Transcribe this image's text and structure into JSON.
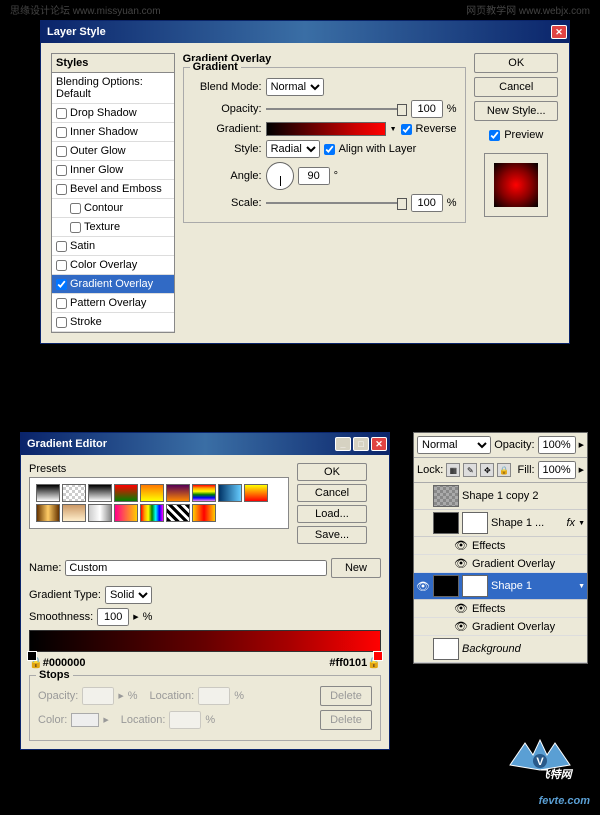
{
  "watermarks": {
    "left": "思缘设计论坛 www.missyuan.com",
    "right": "网页教学网 www.webjx.com",
    "logo": "fevte.com"
  },
  "layerStyle": {
    "title": "Layer Style",
    "stylesHeader": "Styles",
    "blendingOptions": "Blending Options: Default",
    "items": [
      "Drop Shadow",
      "Inner Shadow",
      "Outer Glow",
      "Inner Glow",
      "Bevel and Emboss",
      "Contour",
      "Texture",
      "Satin",
      "Color Overlay",
      "Gradient Overlay",
      "Pattern Overlay",
      "Stroke"
    ],
    "selected": "Gradient Overlay",
    "sectionTitle": "Gradient Overlay",
    "groupLegend": "Gradient",
    "labels": {
      "blendMode": "Blend Mode:",
      "opacity": "Opacity:",
      "gradient": "Gradient:",
      "style": "Style:",
      "angle": "Angle:",
      "scale": "Scale:"
    },
    "blendMode": "Normal",
    "opacity": "100",
    "opacityUnit": "%",
    "reverse": "Reverse",
    "styleValue": "Radial",
    "alignWithLayer": "Align with Layer",
    "angle": "90",
    "angleUnit": "°",
    "scale": "100",
    "scaleUnit": "%",
    "buttons": {
      "ok": "OK",
      "cancel": "Cancel",
      "newStyle": "New Style..."
    },
    "previewLabel": "Preview"
  },
  "gradientEditor": {
    "title": "Gradient Editor",
    "presetsLabel": "Presets",
    "buttons": {
      "ok": "OK",
      "cancel": "Cancel",
      "load": "Load...",
      "save": "Save..."
    },
    "nameLabel": "Name:",
    "nameValue": "Custom",
    "newBtn": "New",
    "gradTypeLabel": "Gradient Type:",
    "gradTypeValue": "Solid",
    "smoothLabel": "Smoothness:",
    "smoothValue": "100",
    "smoothUnit": "%",
    "hexLeft": "#000000",
    "hexRight": "#ff0101",
    "stopsLegend": "Stops",
    "stopLabels": {
      "opacity": "Opacity:",
      "location": "Location:",
      "color": "Color:",
      "delete": "Delete",
      "pct": "%"
    }
  },
  "layersPanel": {
    "blendMode": "Normal",
    "opacityLabel": "Opacity:",
    "opacity": "100%",
    "lockLabel": "Lock:",
    "fillLabel": "Fill:",
    "fill": "100%",
    "layers": [
      "Shape 1 copy 2",
      "Shape 1 ...",
      "Shape 1",
      "Background"
    ],
    "effectsLabel": "Effects",
    "gradOverlayLabel": "Gradient Overlay",
    "fx": "fx"
  }
}
